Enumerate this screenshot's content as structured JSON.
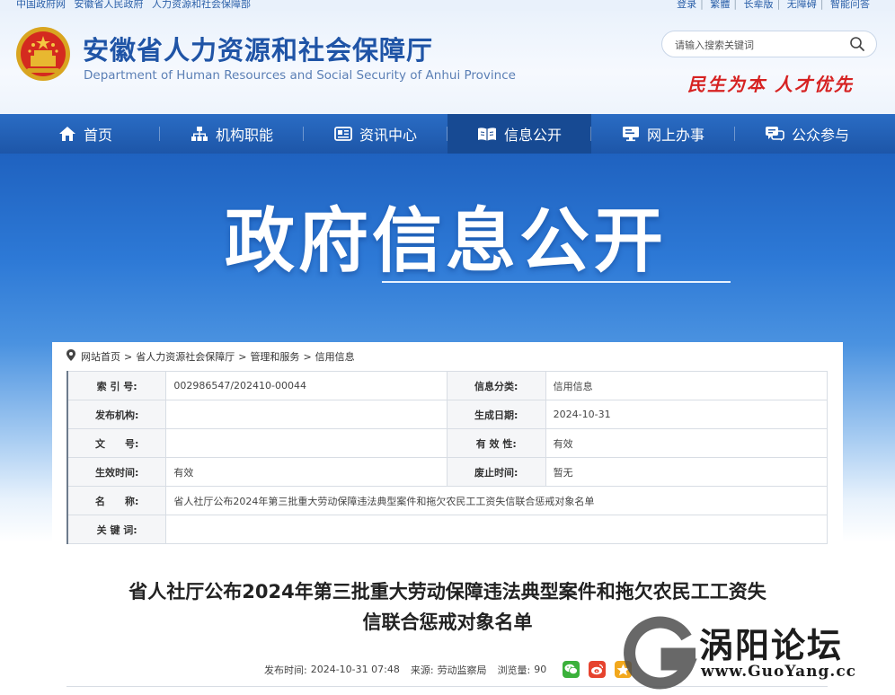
{
  "top_links_left": [
    "中国政府网",
    "安徽省人民政府",
    "人力资源和社会保障部"
  ],
  "top_links_right": [
    "登录",
    "繁體",
    "长辈版",
    "无障碍",
    "智能问答"
  ],
  "header": {
    "title": "安徽省人力资源和社会保障厅",
    "subtitle": "Department of Human Resources and Social Security of Anhui Province",
    "search_placeholder": "请输入搜索关键词",
    "slogan": "民生为本  人才优先"
  },
  "nav": [
    {
      "label": "首页",
      "icon": "home-icon"
    },
    {
      "label": "机构职能",
      "icon": "org-chart-icon"
    },
    {
      "label": "资讯中心",
      "icon": "news-icon"
    },
    {
      "label": "信息公开",
      "icon": "open-book-icon",
      "active": true
    },
    {
      "label": "网上办事",
      "icon": "monitor-icon"
    },
    {
      "label": "公众参与",
      "icon": "chat-icon"
    }
  ],
  "banner": {
    "title": "政府信息公开"
  },
  "breadcrumb": [
    "网站首页",
    "省人力资源社会保障厅",
    "管理和服务",
    "信用信息"
  ],
  "info": {
    "index_label": "索 引 号:",
    "index_value": "002986547/202410-00044",
    "category_label": "信息分类:",
    "category_value": "信用信息",
    "publisher_label": "发布机构:",
    "publisher_value": "",
    "date_label": "生成日期:",
    "date_value": "2024-10-31",
    "docno_label": "文　　号:",
    "docno_value": "",
    "validity_label": "有 效 性:",
    "validity_value": "有效",
    "effective_label": "生效时间:",
    "effective_value": "有效",
    "abolish_label": "废止时间:",
    "abolish_value": "暂无",
    "name_label": "名　　称:",
    "name_value": "省人社厅公布2024年第三批重大劳动保障违法典型案件和拖欠农民工工资失信联合惩戒对象名单",
    "keywords_label": "关 键 词:",
    "keywords_value": ""
  },
  "article": {
    "title_line1": "省人社厅公布2024年第三批重大劳动保障违法典型案件和拖欠农民工工资失",
    "title_line2": "信联合惩戒对象名单",
    "publish_label": "发布时间:",
    "publish_time": "2024-10-31 07:48",
    "source_label": "来源:",
    "source": "劳动监察局",
    "views_label": "浏览量:",
    "views": "90"
  },
  "watermark": {
    "text": "涡阳论坛",
    "url": "www.GuoYang.cc"
  },
  "colors": {
    "primary": "#1f54a6",
    "nav": "#2264ba",
    "nav_active": "#174a93",
    "slogan": "#d62222"
  }
}
